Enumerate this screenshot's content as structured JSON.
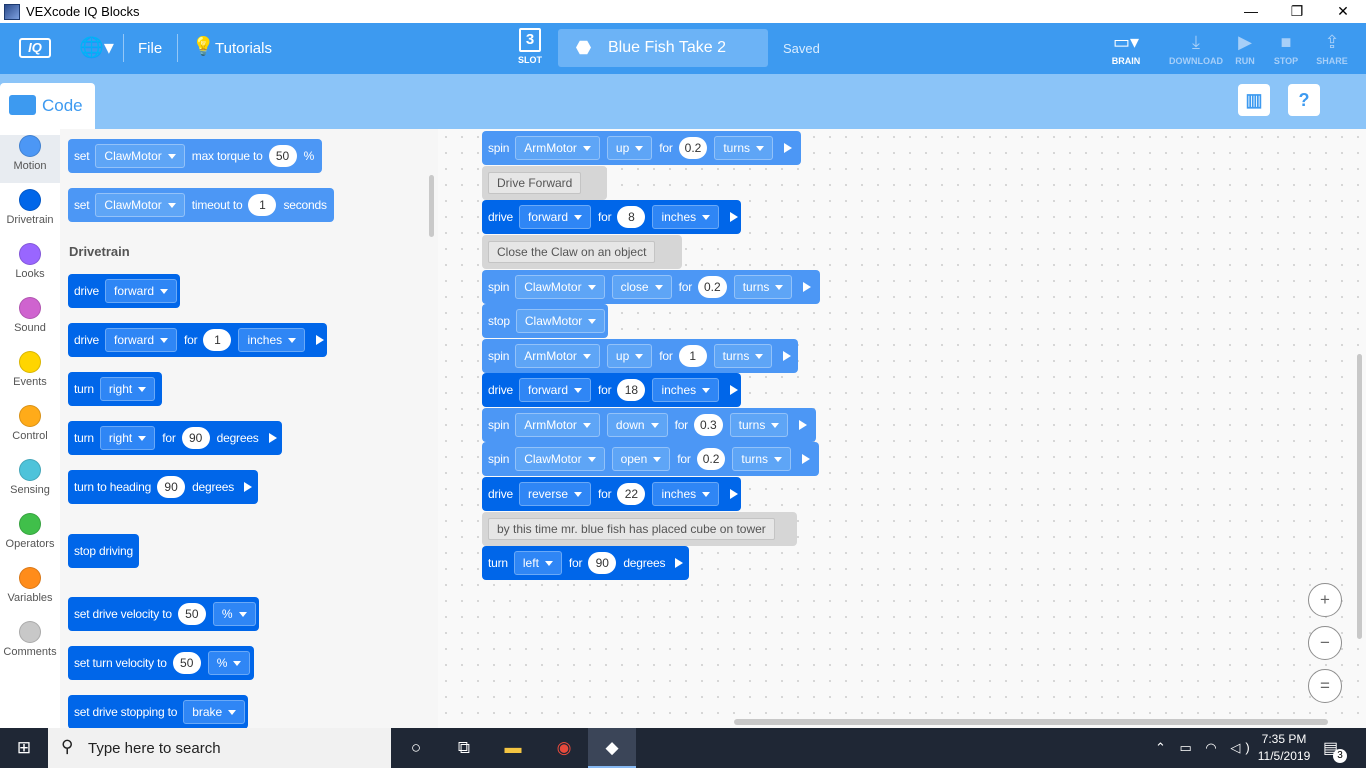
{
  "window": {
    "title": "VEXcode IQ Blocks",
    "minimize_icon": "—",
    "maximize_icon": "❐",
    "close_icon": "✕"
  },
  "toolbar": {
    "logo": "IQ",
    "globe_icon": "🌐▾",
    "file": "File",
    "tutorials": "Tutorials",
    "slot_number": "3",
    "slot_label": "SLOT",
    "project_name": "Blue Fish Take 2",
    "saved_status": "Saved",
    "brain_label": "BRAIN",
    "download_label": "DOWNLOAD",
    "run_label": "RUN",
    "stop_label": "STOP",
    "share_label": "SHARE"
  },
  "code_tab": {
    "label": "Code"
  },
  "categories": [
    {
      "label": "Motion",
      "color": "#4c97f5"
    },
    {
      "label": "Drivetrain",
      "color": "#0066e9"
    },
    {
      "label": "Looks",
      "color": "#9966ff"
    },
    {
      "label": "Sound",
      "color": "#cf63cf"
    },
    {
      "label": "Events",
      "color": "#ffd500"
    },
    {
      "label": "Control",
      "color": "#ffab19"
    },
    {
      "label": "Sensing",
      "color": "#4ec3da"
    },
    {
      "label": "Operators",
      "color": "#40bf4a"
    },
    {
      "label": "Variables",
      "color": "#ff8c1a"
    },
    {
      "label": "Comments",
      "color": "#c8c8c8"
    }
  ],
  "palette": {
    "set_max_torque": {
      "set": "set",
      "motor": "ClawMotor",
      "text": "max torque to",
      "value": "50",
      "unit": "%"
    },
    "set_timeout": {
      "set": "set",
      "motor": "ClawMotor",
      "text": "timeout to",
      "value": "1",
      "unit": "seconds"
    },
    "section_title": "Drivetrain",
    "drive": {
      "kw": "drive",
      "dir": "forward"
    },
    "drive_for": {
      "kw": "drive",
      "dir": "forward",
      "for": "for",
      "value": "1",
      "unit": "inches"
    },
    "turn": {
      "kw": "turn",
      "dir": "right"
    },
    "turn_for": {
      "kw": "turn",
      "dir": "right",
      "for": "for",
      "value": "90",
      "unit": "degrees"
    },
    "turn_heading": {
      "text": "turn to heading",
      "value": "90",
      "unit": "degrees"
    },
    "stop_driving": "stop driving",
    "drive_velocity": {
      "text": "set drive velocity to",
      "value": "50",
      "unit": "%"
    },
    "turn_velocity": {
      "text": "set turn velocity to",
      "value": "50",
      "unit": "%"
    },
    "stopping": {
      "text": "set drive stopping to",
      "mode": "brake"
    }
  },
  "script": {
    "b1": {
      "kw": "spin",
      "motor": "ArmMotor",
      "dir": "up",
      "for": "for",
      "value": "0.2",
      "unit": "turns"
    },
    "c1": "Drive Forward",
    "b2": {
      "kw": "drive",
      "dir": "forward",
      "for": "for",
      "value": "8",
      "unit": "inches"
    },
    "c2": "Close the Claw on an object",
    "b3": {
      "kw": "spin",
      "motor": "ClawMotor",
      "dir": "close",
      "for": "for",
      "value": "0.2",
      "unit": "turns"
    },
    "b4": {
      "kw": "stop",
      "motor": "ClawMotor"
    },
    "b5": {
      "kw": "spin",
      "motor": "ArmMotor",
      "dir": "up",
      "for": "for",
      "value": "1",
      "unit": "turns"
    },
    "b6": {
      "kw": "drive",
      "dir": "forward",
      "for": "for",
      "value": "18",
      "unit": "inches"
    },
    "b7": {
      "kw": "spin",
      "motor": "ArmMotor",
      "dir": "down",
      "for": "for",
      "value": "0.3",
      "unit": "turns"
    },
    "b8": {
      "kw": "spin",
      "motor": "ClawMotor",
      "dir": "open",
      "for": "for",
      "value": "0.2",
      "unit": "turns"
    },
    "b9": {
      "kw": "drive",
      "dir": "reverse",
      "for": "for",
      "value": "22",
      "unit": "inches"
    },
    "c3": "by this time mr. blue fish has placed cube on tower",
    "b10": {
      "kw": "turn",
      "dir": "left",
      "for": "for",
      "value": "90",
      "unit": "degrees"
    }
  },
  "zoom": {
    "in": "+",
    "out": "−",
    "reset": "="
  },
  "taskbar": {
    "search_placeholder": "Type here to search",
    "time": "7:35 PM",
    "date": "11/5/2019",
    "notification_count": "3"
  }
}
